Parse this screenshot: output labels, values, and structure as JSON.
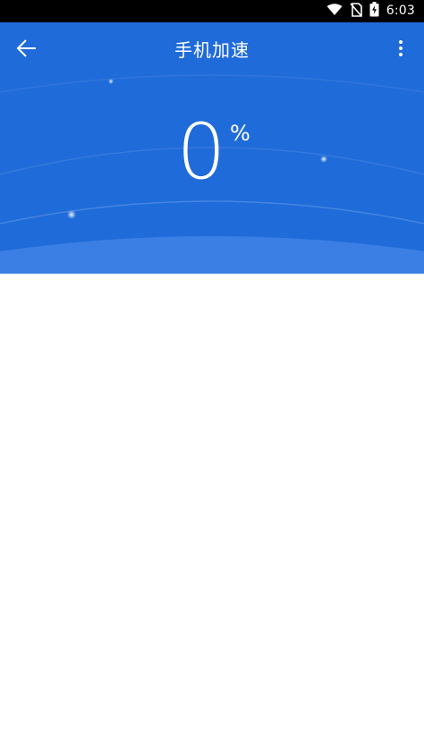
{
  "status_bar": {
    "time": "6:03",
    "icons": [
      "wifi-icon",
      "no-sim-icon",
      "battery-charging-icon"
    ]
  },
  "toolbar": {
    "title": "手机加速",
    "back_icon": "arrow-left-icon",
    "more_icon": "more-vert-icon"
  },
  "boost": {
    "value": "0",
    "unit": "%"
  },
  "colors": {
    "primary": "#1f6bd9",
    "primary_light": "#3b7fe4",
    "status_bar": "#000000",
    "background": "#ffffff"
  }
}
